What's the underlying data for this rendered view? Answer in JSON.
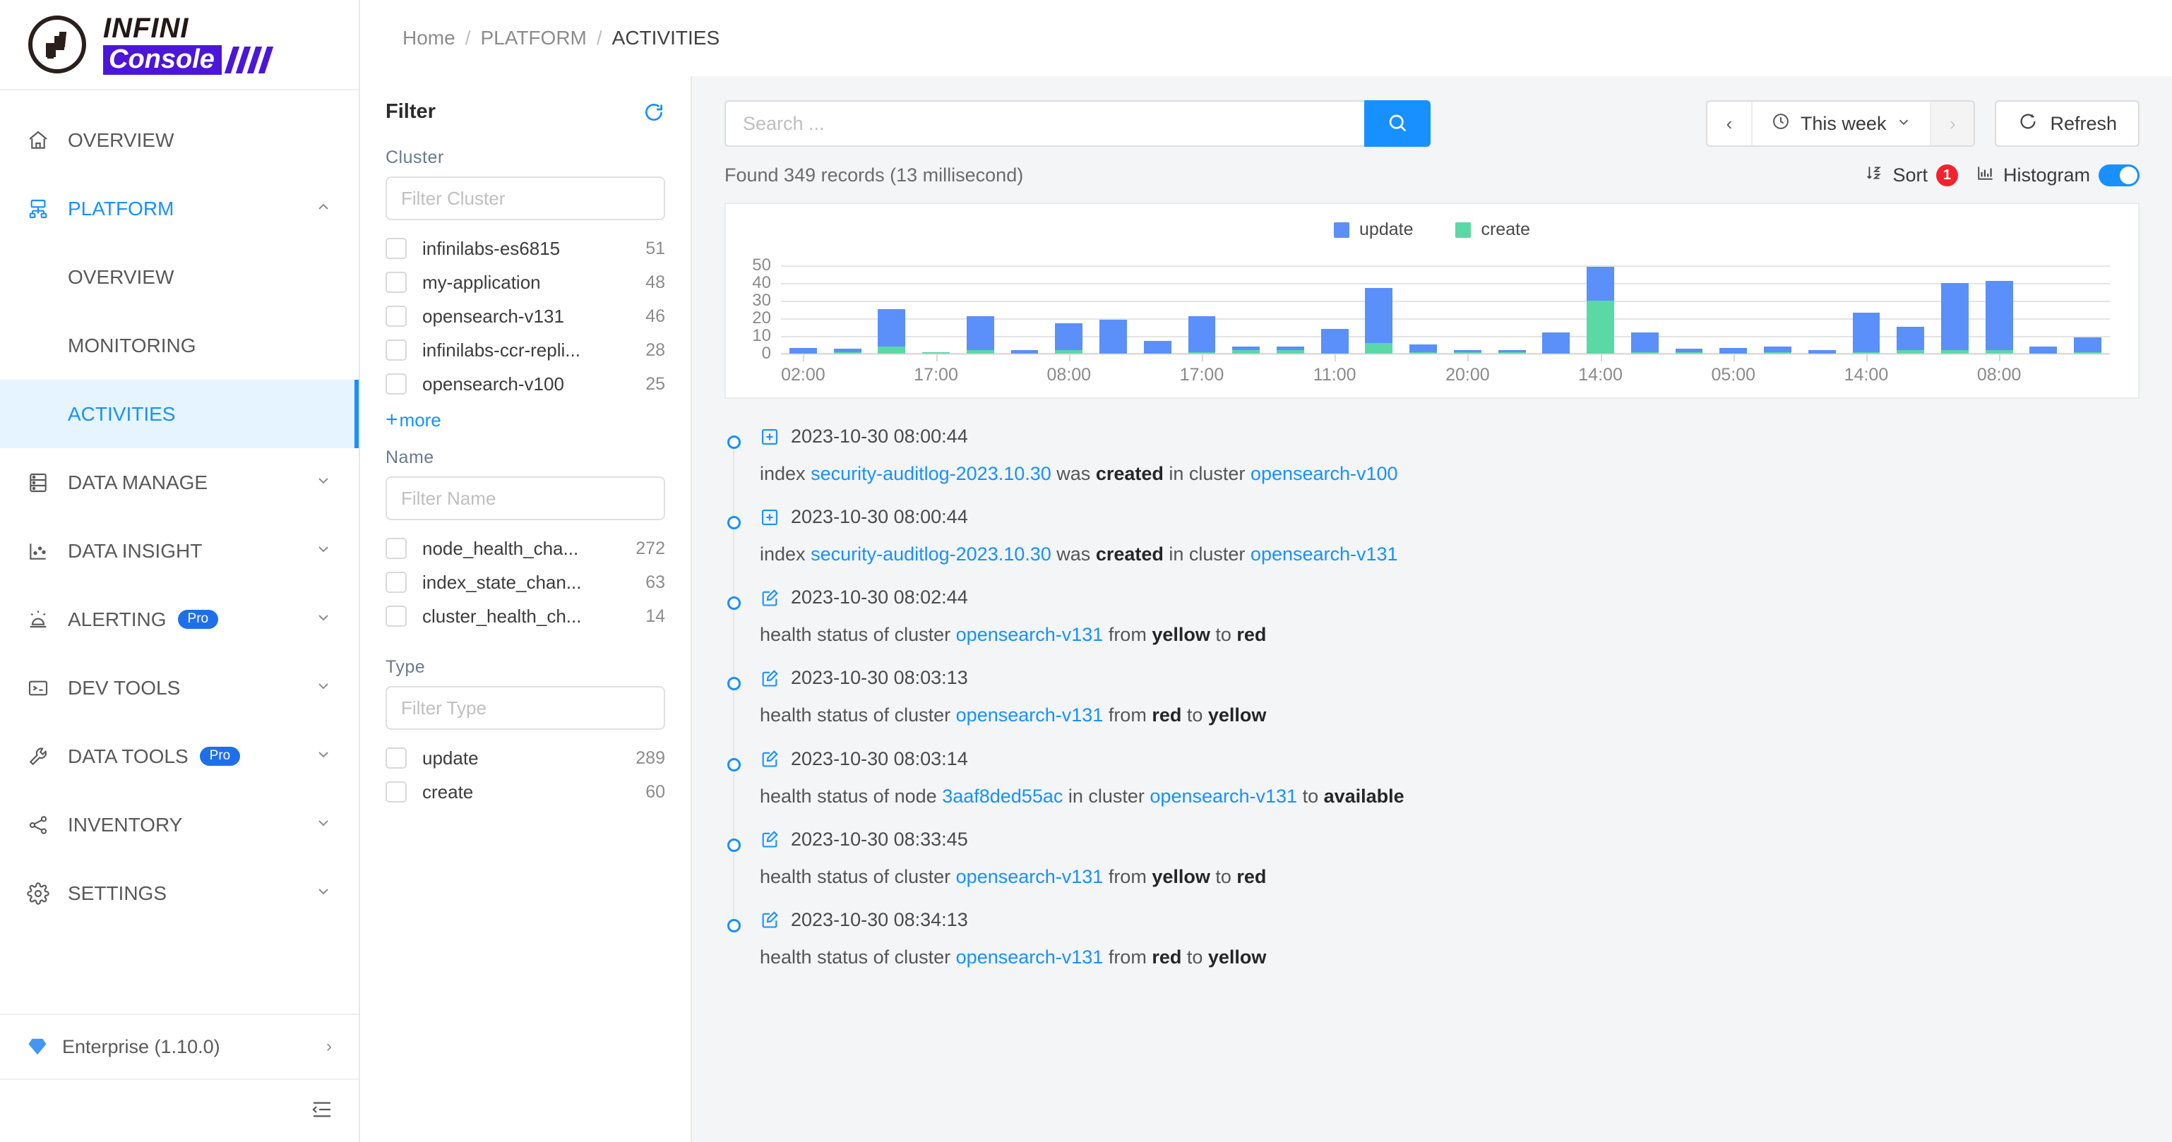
{
  "brand": {
    "name_top": "INFINI",
    "name_bottom": "Console"
  },
  "sidebar": {
    "items": [
      {
        "label": "OVERVIEW",
        "icon": "home-icon",
        "expandable": false
      },
      {
        "label": "PLATFORM",
        "icon": "platform-icon",
        "expandable": true,
        "chevron": "⌃",
        "active": true
      },
      {
        "label": "DATA MANAGE",
        "icon": "database-icon",
        "expandable": true,
        "chevron": "⌄"
      },
      {
        "label": "DATA INSIGHT",
        "icon": "insight-icon",
        "expandable": true,
        "chevron": "⌄"
      },
      {
        "label": "ALERTING",
        "icon": "alert-icon",
        "expandable": true,
        "chevron": "⌄",
        "badge": "Pro"
      },
      {
        "label": "DEV TOOLS",
        "icon": "terminal-icon",
        "expandable": true,
        "chevron": "⌄"
      },
      {
        "label": "DATA TOOLS",
        "icon": "wrench-icon",
        "expandable": true,
        "chevron": "⌄",
        "badge": "Pro"
      },
      {
        "label": "INVENTORY",
        "icon": "share-icon",
        "expandable": true,
        "chevron": "⌄"
      },
      {
        "label": "SETTINGS",
        "icon": "gear-icon",
        "expandable": true,
        "chevron": "⌄"
      }
    ],
    "platform_children": [
      {
        "label": "OVERVIEW",
        "selected": false
      },
      {
        "label": "MONITORING",
        "selected": false
      },
      {
        "label": "ACTIVITIES",
        "selected": true
      }
    ],
    "footer": {
      "label": "Enterprise (1.10.0)",
      "icon": "gem-icon",
      "arrow": "›"
    },
    "collapse_icon": "collapse-sidebar-icon"
  },
  "breadcrumb": {
    "home": "Home",
    "sep": "/",
    "section": "PLATFORM",
    "current": "ACTIVITIES"
  },
  "filter": {
    "title": "Filter",
    "refresh_icon": "refresh-icon",
    "facets": [
      {
        "label": "Cluster",
        "placeholder": "Filter Cluster",
        "options": [
          {
            "name": "infinilabs-es6815",
            "count": "51"
          },
          {
            "name": "my-application",
            "count": "48"
          },
          {
            "name": "opensearch-v131",
            "count": "46"
          },
          {
            "name": "infinilabs-ccr-repli...",
            "count": "28"
          },
          {
            "name": "opensearch-v100",
            "count": "25"
          }
        ],
        "more": "more"
      },
      {
        "label": "Name",
        "placeholder": "Filter Name",
        "options": [
          {
            "name": "node_health_cha...",
            "count": "272"
          },
          {
            "name": "index_state_chan...",
            "count": "63"
          },
          {
            "name": "cluster_health_ch...",
            "count": "14"
          }
        ]
      },
      {
        "label": "Type",
        "placeholder": "Filter Type",
        "options": [
          {
            "name": "update",
            "count": "289"
          },
          {
            "name": "create",
            "count": "60"
          }
        ]
      }
    ]
  },
  "toolbar": {
    "search_placeholder": "Search ...",
    "search_value": "",
    "search_icon": "search-icon",
    "prev_label": "‹",
    "next_label": "›",
    "clock_icon": "clock-icon",
    "range_label": "This week",
    "range_chevron": "⌄",
    "refresh_label": "Refresh",
    "refresh_icon": "refresh-arrow-icon"
  },
  "results": {
    "found_text": "Found 349 records (13 millisecond)",
    "sort_label": "Sort",
    "sort_count": "1",
    "sort_icon": "sort-az-icon",
    "histogram_label": "Histogram",
    "histogram_icon": "histogram-icon",
    "histogram_on": true
  },
  "chart_data": {
    "type": "bar",
    "title": "",
    "stacked": true,
    "xlabel": "",
    "ylabel": "",
    "ylim": [
      0,
      55
    ],
    "yticks": [
      0,
      10,
      20,
      30,
      40,
      50
    ],
    "grid": true,
    "legend_position": "top-center",
    "colors": {
      "update": "#5b8ff9",
      "create": "#5ad8a6"
    },
    "xtick_labels": [
      "02:00",
      "17:00",
      "08:00",
      "17:00",
      "11:00",
      "20:00",
      "14:00",
      "05:00",
      "14:00",
      "08:00"
    ],
    "xtick_indices": [
      0,
      3,
      6,
      9,
      12,
      15,
      18,
      21,
      24,
      27
    ],
    "categories": [
      "b0",
      "b1",
      "b2",
      "b3",
      "b4",
      "b5",
      "b6",
      "b7",
      "b8",
      "b9",
      "b10",
      "b11",
      "b12",
      "b13",
      "b14",
      "b15",
      "b16",
      "b17",
      "b18",
      "b19",
      "b20",
      "b21",
      "b22",
      "b23",
      "b24",
      "b25",
      "b26",
      "b27",
      "b28",
      "b29"
    ],
    "series": [
      {
        "name": "update",
        "values": [
          3,
          2,
          21,
          0,
          19,
          2,
          15,
          19,
          7,
          20,
          2,
          2,
          14,
          31,
          4,
          1,
          1,
          12,
          19,
          11,
          2,
          3,
          3,
          2,
          22,
          13,
          38,
          39,
          4,
          8
        ]
      },
      {
        "name": "create",
        "values": [
          0,
          1,
          4,
          1,
          2,
          0,
          2,
          0,
          0,
          1,
          2,
          2,
          0,
          6,
          1,
          1,
          1,
          0,
          30,
          1,
          1,
          0,
          1,
          0,
          1,
          2,
          2,
          2,
          0,
          1
        ]
      }
    ]
  },
  "activities": [
    {
      "icon": "plus-square-icon",
      "time": "2023-10-30 08:00:44",
      "parts": [
        {
          "t": "index ",
          "k": "plain"
        },
        {
          "t": "security-auditlog-2023.10.30",
          "k": "link"
        },
        {
          "t": " was ",
          "k": "plain"
        },
        {
          "t": "created",
          "k": "bold"
        },
        {
          "t": " in cluster ",
          "k": "plain"
        },
        {
          "t": "opensearch-v100",
          "k": "link"
        }
      ]
    },
    {
      "icon": "plus-square-icon",
      "time": "2023-10-30 08:00:44",
      "parts": [
        {
          "t": "index ",
          "k": "plain"
        },
        {
          "t": "security-auditlog-2023.10.30",
          "k": "link"
        },
        {
          "t": " was ",
          "k": "plain"
        },
        {
          "t": "created",
          "k": "bold"
        },
        {
          "t": " in cluster ",
          "k": "plain"
        },
        {
          "t": "opensearch-v131",
          "k": "link"
        }
      ]
    },
    {
      "icon": "edit-square-icon",
      "time": "2023-10-30 08:02:44",
      "parts": [
        {
          "t": "health status of cluster ",
          "k": "plain"
        },
        {
          "t": "opensearch-v131",
          "k": "link"
        },
        {
          "t": " from ",
          "k": "plain"
        },
        {
          "t": "yellow",
          "k": "bold"
        },
        {
          "t": " to ",
          "k": "plain"
        },
        {
          "t": "red",
          "k": "bold"
        }
      ]
    },
    {
      "icon": "edit-square-icon",
      "time": "2023-10-30 08:03:13",
      "parts": [
        {
          "t": "health status of cluster ",
          "k": "plain"
        },
        {
          "t": "opensearch-v131",
          "k": "link"
        },
        {
          "t": " from ",
          "k": "plain"
        },
        {
          "t": "red",
          "k": "bold"
        },
        {
          "t": " to ",
          "k": "plain"
        },
        {
          "t": "yellow",
          "k": "bold"
        }
      ]
    },
    {
      "icon": "edit-square-icon",
      "time": "2023-10-30 08:03:14",
      "parts": [
        {
          "t": "health status of node ",
          "k": "plain"
        },
        {
          "t": "3aaf8ded55ac",
          "k": "link"
        },
        {
          "t": " in cluster ",
          "k": "plain"
        },
        {
          "t": "opensearch-v131",
          "k": "link"
        },
        {
          "t": " to ",
          "k": "plain"
        },
        {
          "t": "available",
          "k": "bold"
        }
      ]
    },
    {
      "icon": "edit-square-icon",
      "time": "2023-10-30 08:33:45",
      "parts": [
        {
          "t": "health status of cluster ",
          "k": "plain"
        },
        {
          "t": "opensearch-v131",
          "k": "link"
        },
        {
          "t": " from ",
          "k": "plain"
        },
        {
          "t": "yellow",
          "k": "bold"
        },
        {
          "t": " to ",
          "k": "plain"
        },
        {
          "t": "red",
          "k": "bold"
        }
      ]
    },
    {
      "icon": "edit-square-icon",
      "time": "2023-10-30 08:34:13",
      "parts": [
        {
          "t": "health status of cluster ",
          "k": "plain"
        },
        {
          "t": "opensearch-v131",
          "k": "link"
        },
        {
          "t": " from ",
          "k": "plain"
        },
        {
          "t": "red",
          "k": "bold"
        },
        {
          "t": " to ",
          "k": "plain"
        },
        {
          "t": "yellow",
          "k": "bold"
        }
      ]
    }
  ]
}
